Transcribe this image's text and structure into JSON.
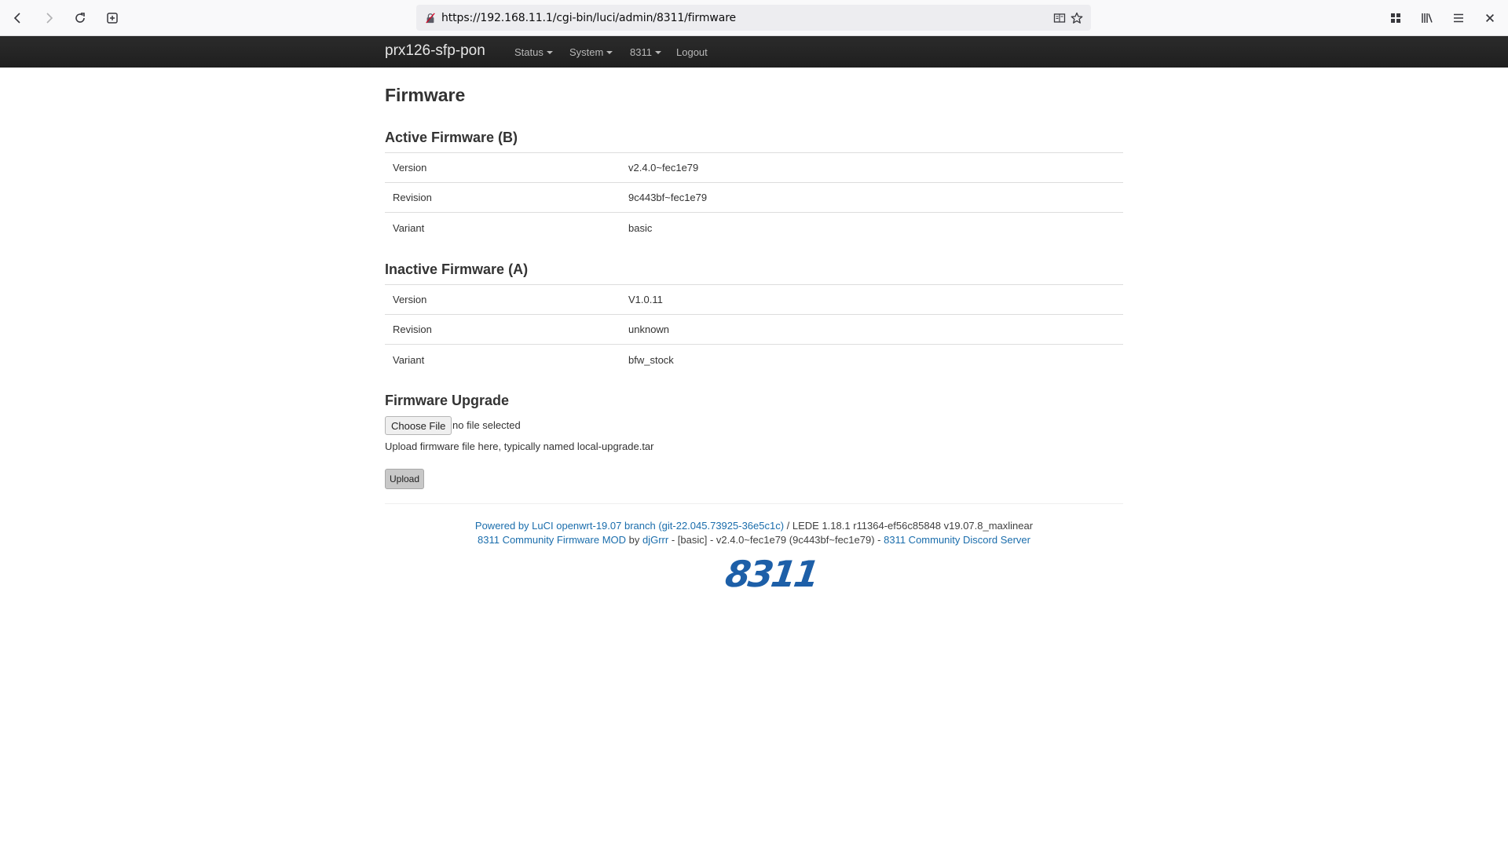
{
  "browser": {
    "url": "https://192.168.11.1/cgi-bin/luci/admin/8311/firmware"
  },
  "header": {
    "brand": "prx126-sfp-pon",
    "menu": [
      {
        "label": "Status"
      },
      {
        "label": "System"
      },
      {
        "label": "8311"
      },
      {
        "label": "Logout"
      }
    ]
  },
  "page": {
    "title": "Firmware"
  },
  "active": {
    "title": "Active Firmware (B)",
    "rows": [
      {
        "key": "Version",
        "value": "v2.4.0~fec1e79"
      },
      {
        "key": "Revision",
        "value": "9c443bf~fec1e79"
      },
      {
        "key": "Variant",
        "value": "basic"
      }
    ]
  },
  "inactive": {
    "title": "Inactive Firmware (A)",
    "rows": [
      {
        "key": "Version",
        "value": "V1.0.11"
      },
      {
        "key": "Revision",
        "value": "unknown"
      },
      {
        "key": "Variant",
        "value": "bfw_stock"
      }
    ]
  },
  "upgrade": {
    "title": "Firmware Upgrade",
    "choose_label": "Choose File",
    "file_status": "no file selected",
    "help": "Upload firmware file here, typically named local-upgrade.tar",
    "upload_label": "Upload"
  },
  "footer": {
    "powered_link": "Powered by LuCI openwrt-19.07 branch (git-22.045.73925-36e5c1c)",
    "lede_text": " / LEDE 1.18.1 r11364-ef56c85848 v19.07.8_maxlinear",
    "mod_link": "8311 Community Firmware MOD",
    "by_text": " by ",
    "author_link": "djGrrr",
    "version_text": " - [basic] - v2.4.0~fec1e79 (9c443bf~fec1e79) - ",
    "discord_link": "8311 Community Discord Server",
    "logo_text": "8311"
  }
}
